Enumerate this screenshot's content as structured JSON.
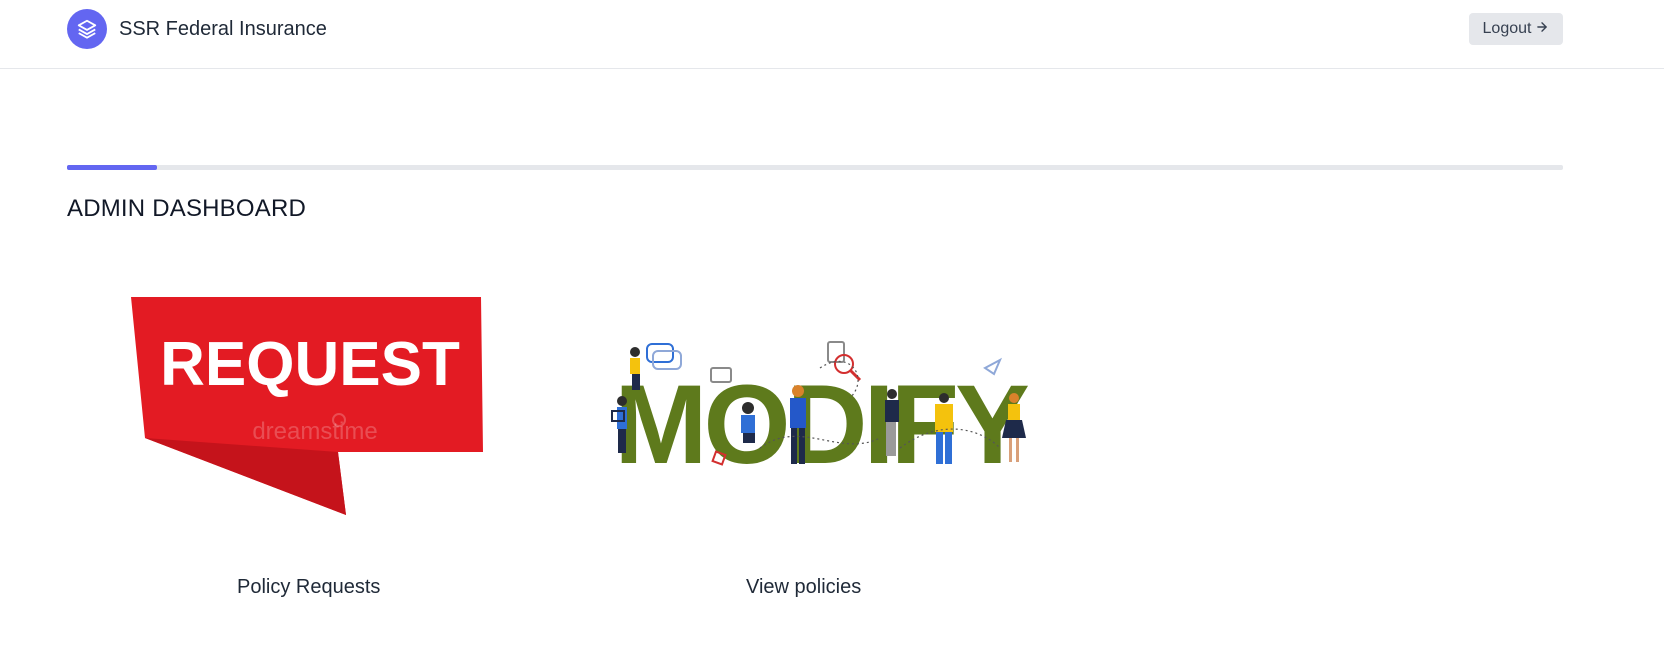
{
  "header": {
    "brand_name": "SSR Federal Insurance",
    "logo_icon": "layers-icon",
    "logout_label": "Logout",
    "logout_icon": "arrow-right-icon"
  },
  "progress": {
    "value_percent": 6
  },
  "page": {
    "title": "ADMIN DASHBOARD"
  },
  "cards": [
    {
      "image_text": "REQUEST",
      "watermark": "dreamstime",
      "caption": "Policy Requests"
    },
    {
      "image_text": "MODIFY",
      "caption": "View policies"
    }
  ],
  "colors": {
    "accent": "#6366f1",
    "request_red": "#e31b23",
    "modify_green": "#5e7a1c"
  }
}
